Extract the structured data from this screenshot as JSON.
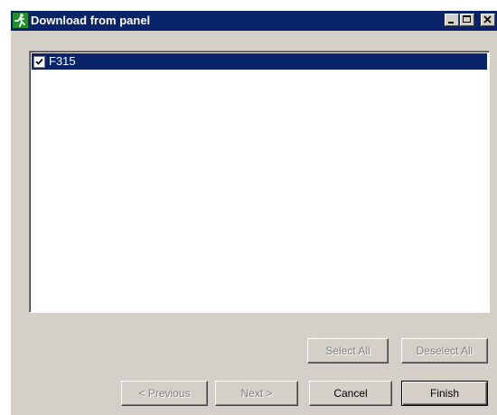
{
  "window": {
    "title": "Download from panel",
    "icon": "running-man-icon",
    "title_bar_color": "#0a246a",
    "face_color": "#d4d0c8"
  },
  "list": {
    "items": [
      {
        "label": "F315",
        "checked": true,
        "selected": true
      }
    ],
    "selection_color": "#0a246a"
  },
  "buttons": {
    "select_all": "Select All",
    "deselect_all": "Deselect All",
    "previous": "< Previous",
    "next": "Next >",
    "cancel": "Cancel",
    "finish": "Finish"
  },
  "button_states": {
    "select_all": "disabled",
    "deselect_all": "disabled",
    "previous": "disabled",
    "next": "disabled",
    "cancel": "enabled",
    "finish": "default"
  }
}
